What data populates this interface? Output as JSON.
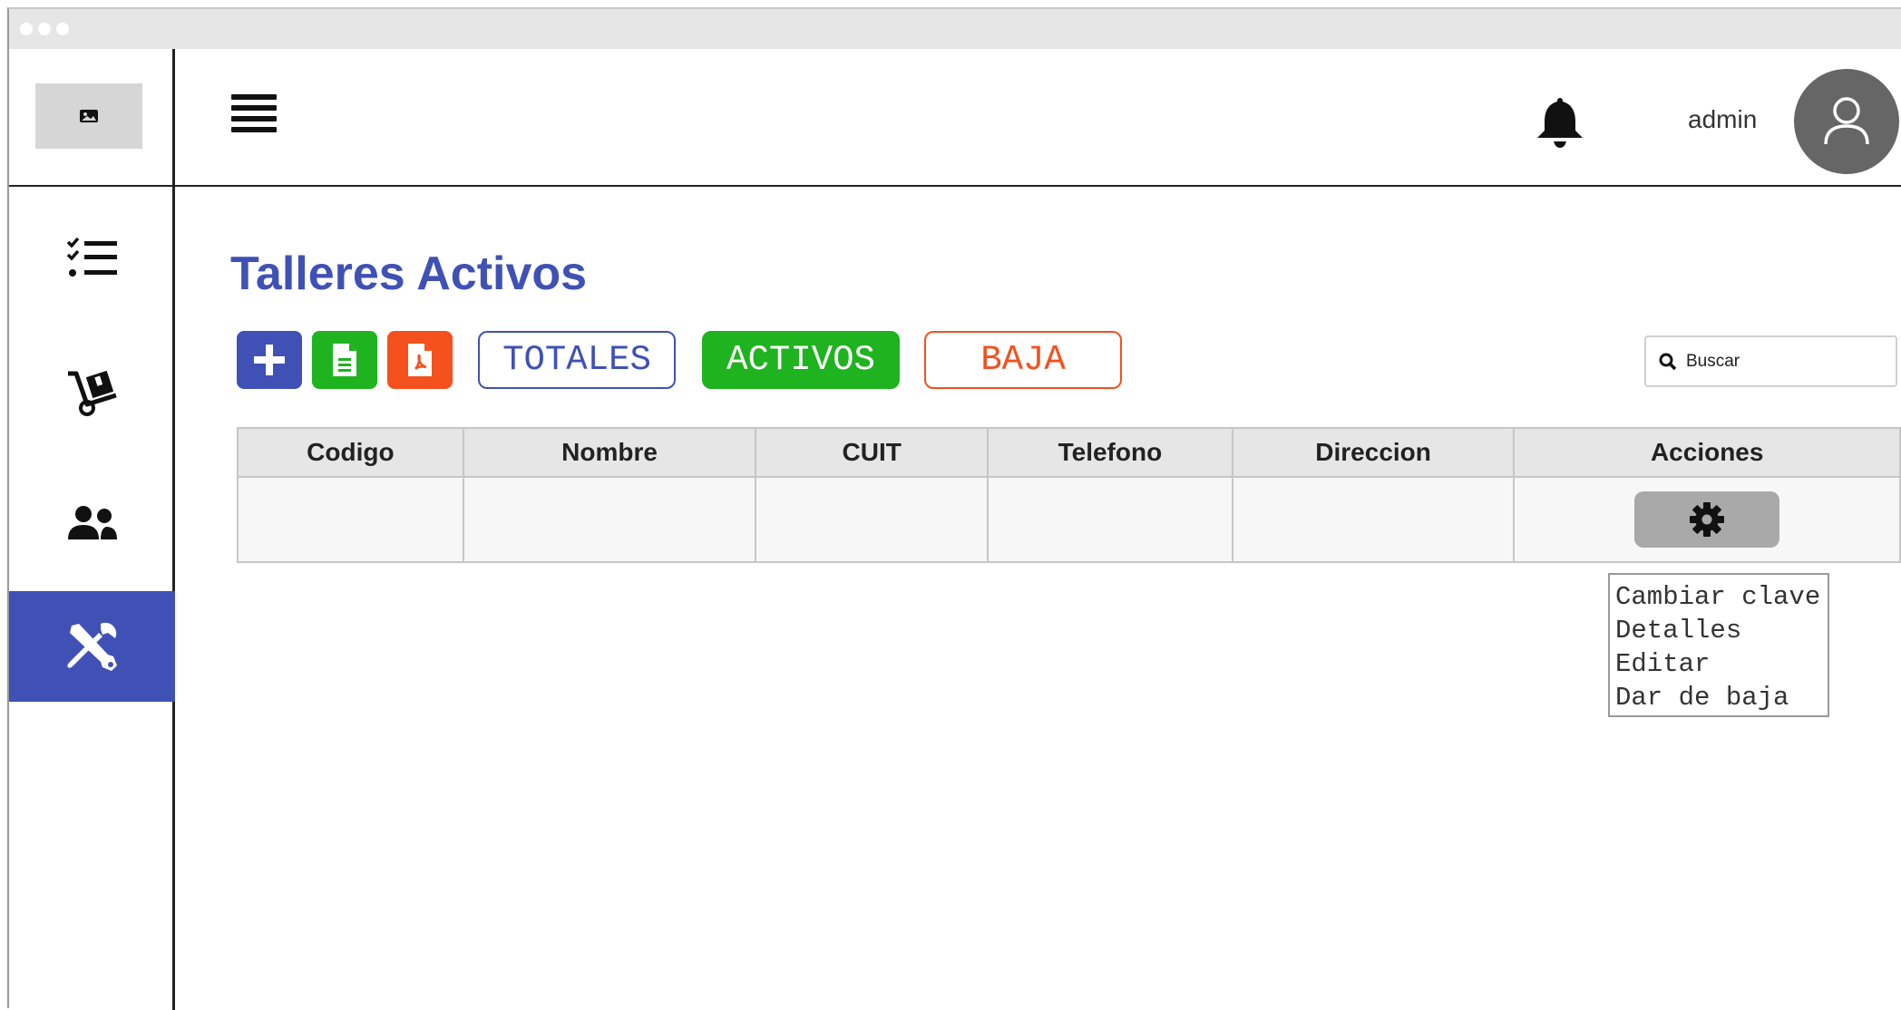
{
  "header": {
    "user_name": "admin"
  },
  "sidebar": {
    "items": [
      {
        "icon": "checklist-icon"
      },
      {
        "icon": "dolly-icon"
      },
      {
        "icon": "users-icon"
      },
      {
        "icon": "tools-icon",
        "active": true
      }
    ]
  },
  "main": {
    "title": "Talleres Activos",
    "toolbar": {
      "add_icon": "plus-icon",
      "excel_icon": "file-excel-icon",
      "pdf_icon": "file-pdf-icon",
      "filters": [
        "TOTALES",
        "ACTIVOS",
        "BAJA"
      ]
    },
    "search": {
      "placeholder": "Buscar"
    },
    "table": {
      "columns": [
        "Codigo",
        "Nombre",
        "CUIT",
        "Telefono",
        "Direccion",
        "Acciones"
      ],
      "rows": [
        {
          "codigo": "",
          "nombre": "",
          "cuit": "",
          "telefono": "",
          "direccion": ""
        }
      ]
    },
    "actions_menu": [
      "Cambiar clave",
      "Detalles",
      "Editar",
      "Dar de baja"
    ]
  },
  "colors": {
    "brand": "#3f51b5",
    "add": "#3f51b5",
    "excel": "#1fb31f",
    "pdf": "#f4511e",
    "totales": "#3f51b5",
    "activos": "#1fb31f",
    "baja": "#f4511e"
  }
}
